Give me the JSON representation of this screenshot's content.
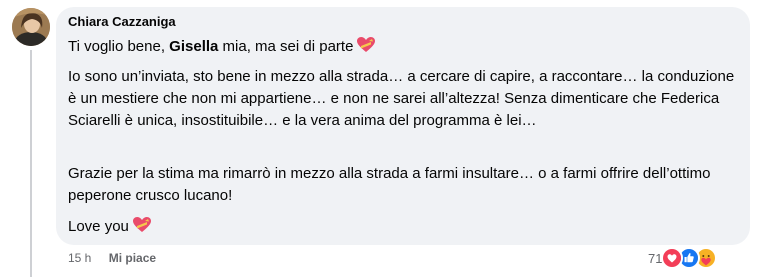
{
  "comment": {
    "author": "Chiara Cazzaniga",
    "para1": {
      "before": "Ti voglio bene, ",
      "bold": "Gisella",
      "after": " mia, ma sei di parte"
    },
    "para2": "Io sono un’inviata, sto bene in mezzo alla strada… a cercare di capire, a raccontare… la conduzione è un mestiere che non mi appartiene… e non ne sarei all’altezza! Senza dimenticare che Federica Sciarelli è unica, insostituibile… e la vera anima del programma è lei…",
    "para3": "Grazie per la stima ma rimarrò in mezzo alla strada a farmi insultare… o a farmi offrire dell’ottimo peperone crusco lucano!",
    "para4": "Love you",
    "emoji": "heart-with-ribbon-icon"
  },
  "footer": {
    "timestamp": "15 h",
    "like_label": "Mi piace",
    "reaction_count": "71",
    "reactions": [
      "love-reaction-icon",
      "like-reaction-icon",
      "care-reaction-icon"
    ]
  },
  "colors": {
    "bubble": "#f0f2f5",
    "text": "#050505",
    "meta": "#65676b",
    "love": "#f33e58",
    "like": "#1877f2",
    "care": "#f7b125"
  }
}
